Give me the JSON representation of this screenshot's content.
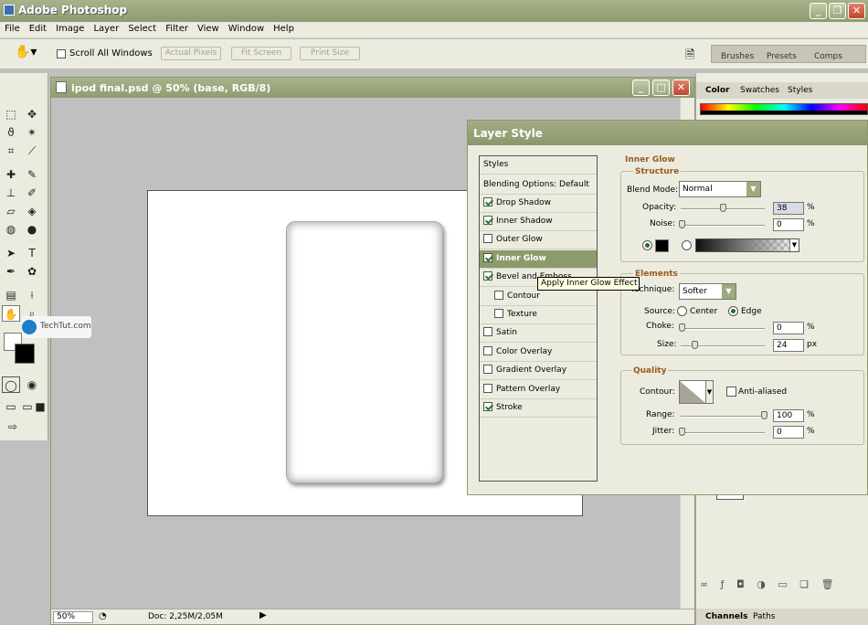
{
  "app": {
    "title": "Adobe Photoshop"
  },
  "menu": [
    "File",
    "Edit",
    "Image",
    "Layer",
    "Select",
    "Filter",
    "View",
    "Window",
    "Help"
  ],
  "options": {
    "scroll_all_windows": "Scroll All Windows",
    "actual_pixels": "Actual Pixels",
    "fit_screen": "Fit Screen",
    "print_size": "Print Size"
  },
  "palette_well": {
    "tabs": [
      "Brushes",
      "Presets",
      "Comps"
    ]
  },
  "document": {
    "title": "ipod final.psd @ 50% (base, RGB/8)",
    "zoom": "50%",
    "doc_size": "Doc: 2,25M/2,05M"
  },
  "watermark": "TechTut.com",
  "right_panel": {
    "top_tabs": [
      "Color",
      "Swatches",
      "Styles"
    ],
    "bottom_tabs": [
      "Channels",
      "Paths"
    ]
  },
  "dialog": {
    "title": "Layer Style",
    "styles_header": "Styles",
    "blending": "Blending Options: Default",
    "items": [
      {
        "label": "Drop Shadow",
        "checked": true
      },
      {
        "label": "Inner Shadow",
        "checked": true
      },
      {
        "label": "Outer Glow",
        "checked": false
      },
      {
        "label": "Inner Glow",
        "checked": true,
        "selected": true
      },
      {
        "label": "Bevel and Emboss",
        "checked": true
      },
      {
        "label": "Contour",
        "checked": false,
        "sub": true
      },
      {
        "label": "Texture",
        "checked": false,
        "sub": true
      },
      {
        "label": "Satin",
        "checked": false
      },
      {
        "label": "Color Overlay",
        "checked": false
      },
      {
        "label": "Gradient Overlay",
        "checked": false
      },
      {
        "label": "Pattern Overlay",
        "checked": false
      },
      {
        "label": "Stroke",
        "checked": true
      }
    ],
    "tooltip": "Apply Inner Glow Effect",
    "inner_glow": {
      "heading": "Inner Glow",
      "structure": "Structure",
      "blend_mode_label": "Blend Mode:",
      "blend_mode": "Normal",
      "opacity_label": "Opacity:",
      "opacity": "38",
      "noise_label": "Noise:",
      "noise": "0",
      "pct": "%",
      "elements": "Elements",
      "technique_label": "Technique:",
      "technique": "Softer",
      "source_label": "Source:",
      "center": "Center",
      "edge": "Edge",
      "choke_label": "Choke:",
      "choke": "0",
      "size_label": "Size:",
      "size": "24",
      "px": "px",
      "quality": "Quality",
      "contour_label": "Contour:",
      "anti_aliased": "Anti-aliased",
      "range_label": "Range:",
      "range": "100",
      "jitter_label": "Jitter:",
      "jitter": "0"
    }
  }
}
